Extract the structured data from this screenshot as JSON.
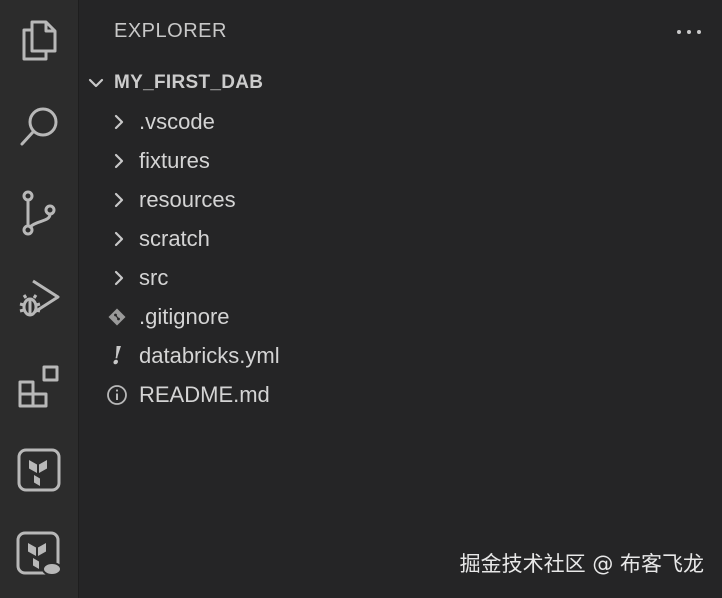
{
  "activity_bar": {
    "items": [
      {
        "name": "explorer",
        "icon": "files-icon"
      },
      {
        "name": "search",
        "icon": "search-icon"
      },
      {
        "name": "source-control",
        "icon": "source-control-icon"
      },
      {
        "name": "run-and-debug",
        "icon": "run-debug-icon"
      },
      {
        "name": "extensions",
        "icon": "extensions-icon"
      },
      {
        "name": "terraform",
        "icon": "terraform-icon"
      },
      {
        "name": "terraform-cloud",
        "icon": "terraform-cloud-icon"
      }
    ]
  },
  "sidebar": {
    "title": "EXPLORER",
    "more_actions": "···",
    "root": {
      "label": "MY_FIRST_DAB",
      "expanded": true
    },
    "items": [
      {
        "label": ".vscode",
        "type": "folder"
      },
      {
        "label": "fixtures",
        "type": "folder"
      },
      {
        "label": "resources",
        "type": "folder"
      },
      {
        "label": "scratch",
        "type": "folder"
      },
      {
        "label": "src",
        "type": "folder"
      },
      {
        "label": ".gitignore",
        "type": "file",
        "icon": "git-icon"
      },
      {
        "label": "databricks.yml",
        "type": "file",
        "icon": "yaml-icon",
        "icon_glyph": "!"
      },
      {
        "label": "README.md",
        "type": "file",
        "icon": "info-icon"
      }
    ]
  },
  "watermark": "掘金技术社区 @ 布客飞龙",
  "colors": {
    "activity_bar_bg": "#2c2c2c",
    "sidebar_bg": "#252526",
    "text": "#d4d4d4",
    "icon": "#b8b8b8"
  }
}
